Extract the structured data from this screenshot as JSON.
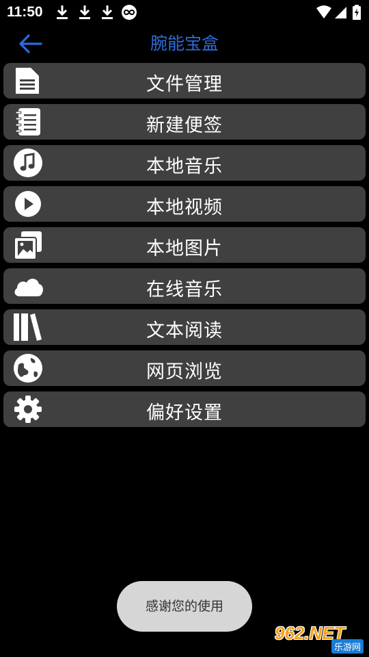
{
  "status_bar": {
    "time": "11:50",
    "left_icons": [
      "download-icon",
      "download-icon",
      "download-icon",
      "infinity-icon"
    ],
    "right_icons": [
      "wifi-icon",
      "signal-icon",
      "battery-charging-icon"
    ]
  },
  "app_bar": {
    "title": "腕能宝盒",
    "back_icon": "arrow-left-icon",
    "accent_color": "#2e6bd9"
  },
  "menu": {
    "items": [
      {
        "label": "文件管理",
        "icon": "file-icon"
      },
      {
        "label": "新建便签",
        "icon": "notepad-icon"
      },
      {
        "label": "本地音乐",
        "icon": "music-note-icon"
      },
      {
        "label": "本地视频",
        "icon": "play-circle-icon"
      },
      {
        "label": "本地图片",
        "icon": "images-icon"
      },
      {
        "label": "在线音乐",
        "icon": "cloud-icon"
      },
      {
        "label": "文本阅读",
        "icon": "books-icon"
      },
      {
        "label": "网页浏览",
        "icon": "globe-icon"
      },
      {
        "label": "偏好设置",
        "icon": "gear-icon"
      }
    ],
    "item_color": "#404040"
  },
  "toast": {
    "text": "感谢您的使用"
  },
  "watermark": {
    "brand": "962.NET",
    "sub": "乐游网"
  }
}
